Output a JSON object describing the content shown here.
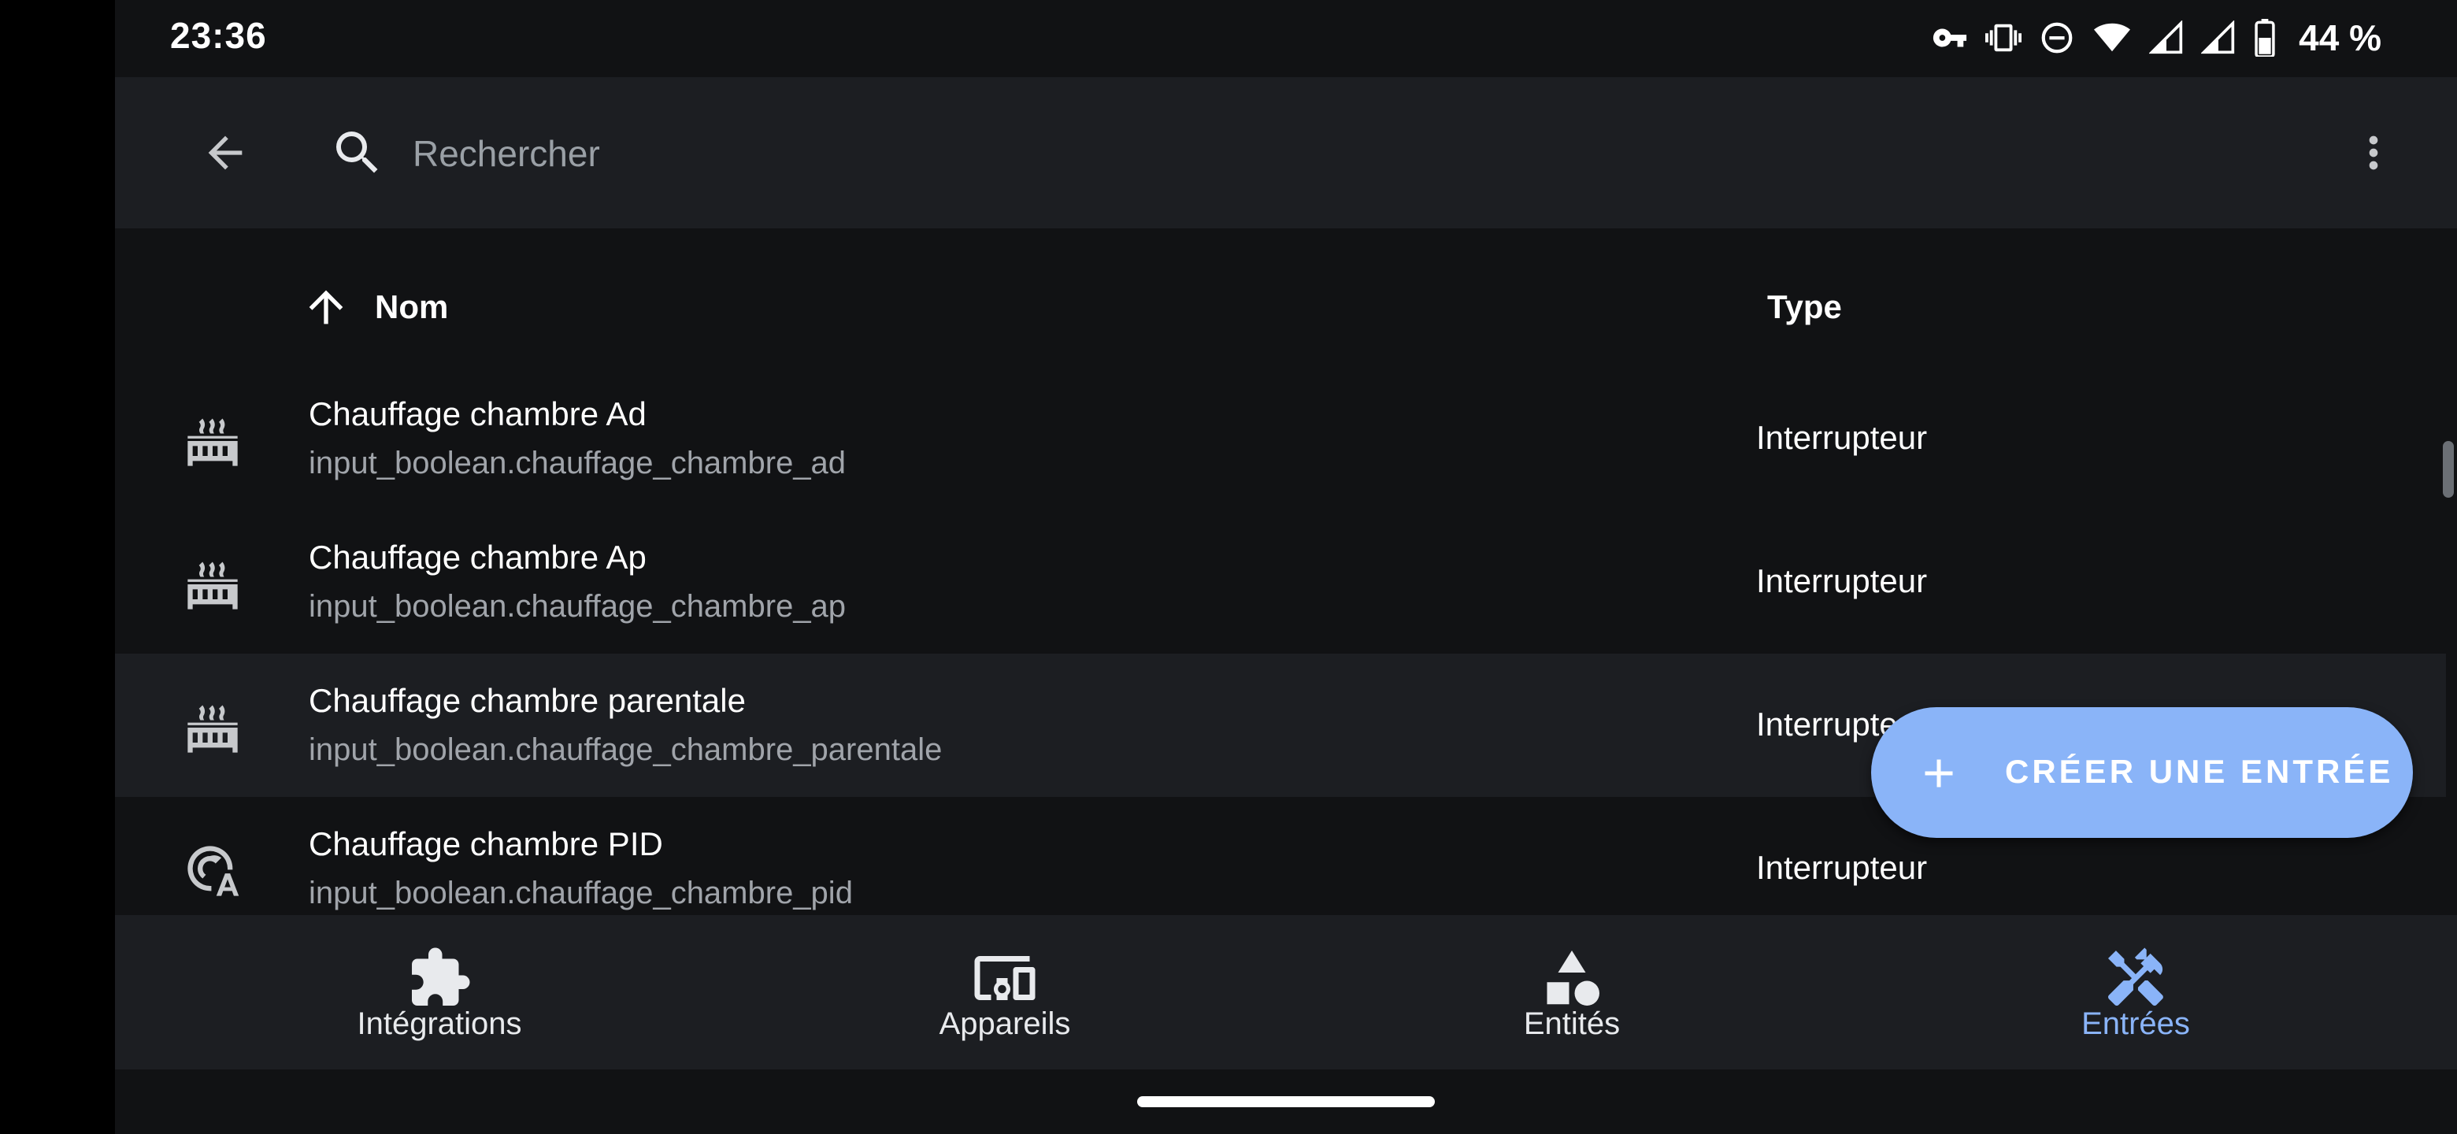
{
  "status_bar": {
    "time": "23:36",
    "icons": [
      "vpn-key-icon",
      "vibrate-icon",
      "do-not-disturb-icon",
      "wifi-icon",
      "signal-icon",
      "signal-icon-2",
      "battery-icon"
    ],
    "battery_percent": "44 %"
  },
  "top_bar": {
    "back_icon": "arrow-left-icon",
    "search_icon": "search-icon",
    "search_placeholder": "Rechercher",
    "search_value": "",
    "more_icon": "more-vert-icon"
  },
  "table": {
    "columns": [
      {
        "label": "Nom",
        "sort": "ascending"
      },
      {
        "label": "Type"
      }
    ],
    "rows": [
      {
        "icon": "radiator-icon",
        "name": "Chauffage chambre Ad",
        "entity_id": "input_boolean.chauffage_chambre_ad",
        "type": "Interrupteur"
      },
      {
        "icon": "radiator-icon",
        "name": "Chauffage chambre Ap",
        "entity_id": "input_boolean.chauffage_chambre_ap",
        "type": "Interrupteur"
      },
      {
        "icon": "radiator-icon",
        "name": "Chauffage chambre parentale",
        "entity_id": "input_boolean.chauffage_chambre_parentale",
        "type": "Interrupteur"
      },
      {
        "icon": "thermostat-auto-icon",
        "name": "Chauffage chambre PID",
        "entity_id": "input_boolean.chauffage_chambre_pid",
        "type": "Interrupteur"
      }
    ]
  },
  "fab": {
    "icon": "plus-icon",
    "label": "CRÉER UNE ENTRÉE"
  },
  "bottom_nav": {
    "items": [
      {
        "icon": "puzzle-icon",
        "label": "Intégrations",
        "active": false
      },
      {
        "icon": "devices-icon",
        "label": "Appareils",
        "active": false
      },
      {
        "icon": "shapes-icon",
        "label": "Entités",
        "active": false
      },
      {
        "icon": "tools-icon",
        "label": "Entrées",
        "active": true
      }
    ]
  },
  "colors": {
    "accent": "#8ab4f8",
    "background": "#111214",
    "surface": "#1c1e22",
    "text_primary": "#ffffff",
    "text_secondary": "#a0a4aa"
  }
}
